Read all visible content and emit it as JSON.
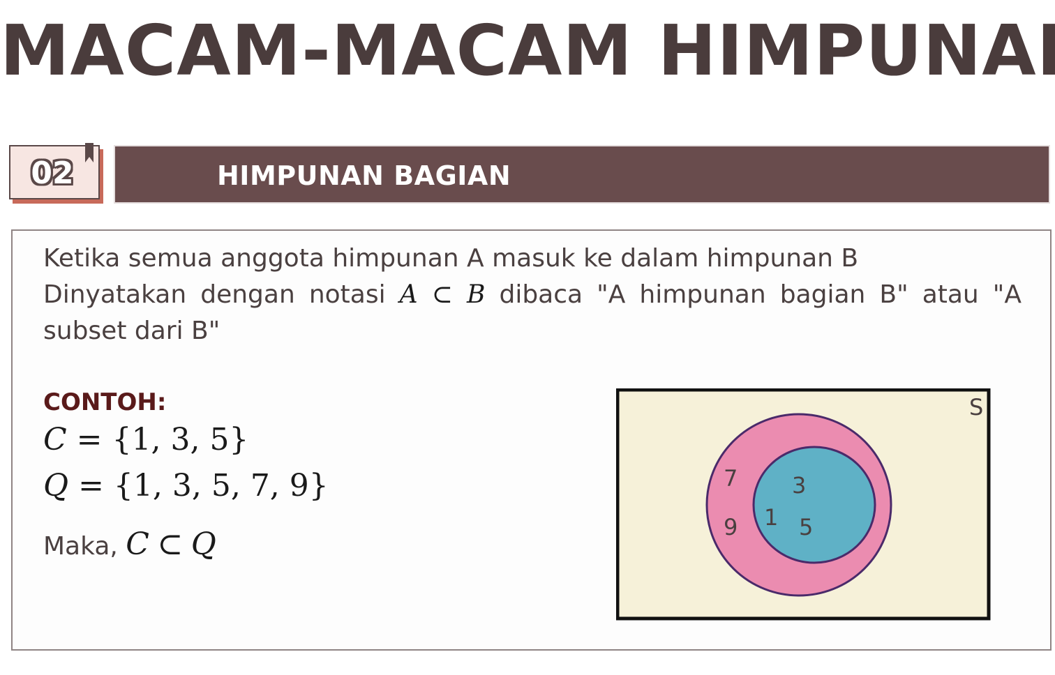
{
  "title": "MACAM-MACAM HIMPUNAN",
  "section": {
    "number": "02",
    "title": "HIMPUNAN BAGIAN"
  },
  "description": {
    "line1": "Ketika semua anggota himpunan A masuk ke dalam himpunan B",
    "line2_pre": "Dinyatakan dengan notasi ",
    "notation_left": "A",
    "subset_symbol": "⊂",
    "notation_right": "B",
    "line2_post": " dibaca \"A himpunan bagian B\" atau \"A subset dari B\""
  },
  "example": {
    "label": "CONTOH:",
    "set_c_name": "C",
    "set_c_members": " = {1, 3, 5}",
    "set_q_name": "Q",
    "set_q_members": " = {1, 3, 5, 7, 9}",
    "conclusion_prefix": "Maka, ",
    "conclusion_left": "C",
    "conclusion_symbol": "⊂",
    "conclusion_right": "Q"
  },
  "venn": {
    "universe_label": "S",
    "outer_only": [
      "7",
      "9"
    ],
    "inner": [
      "3",
      "1",
      "5"
    ],
    "colors": {
      "universe": "#f6f1d9",
      "outer": "#eb8cb0",
      "inner": "#5fb1c6",
      "stroke": "#4a2a6a"
    }
  }
}
